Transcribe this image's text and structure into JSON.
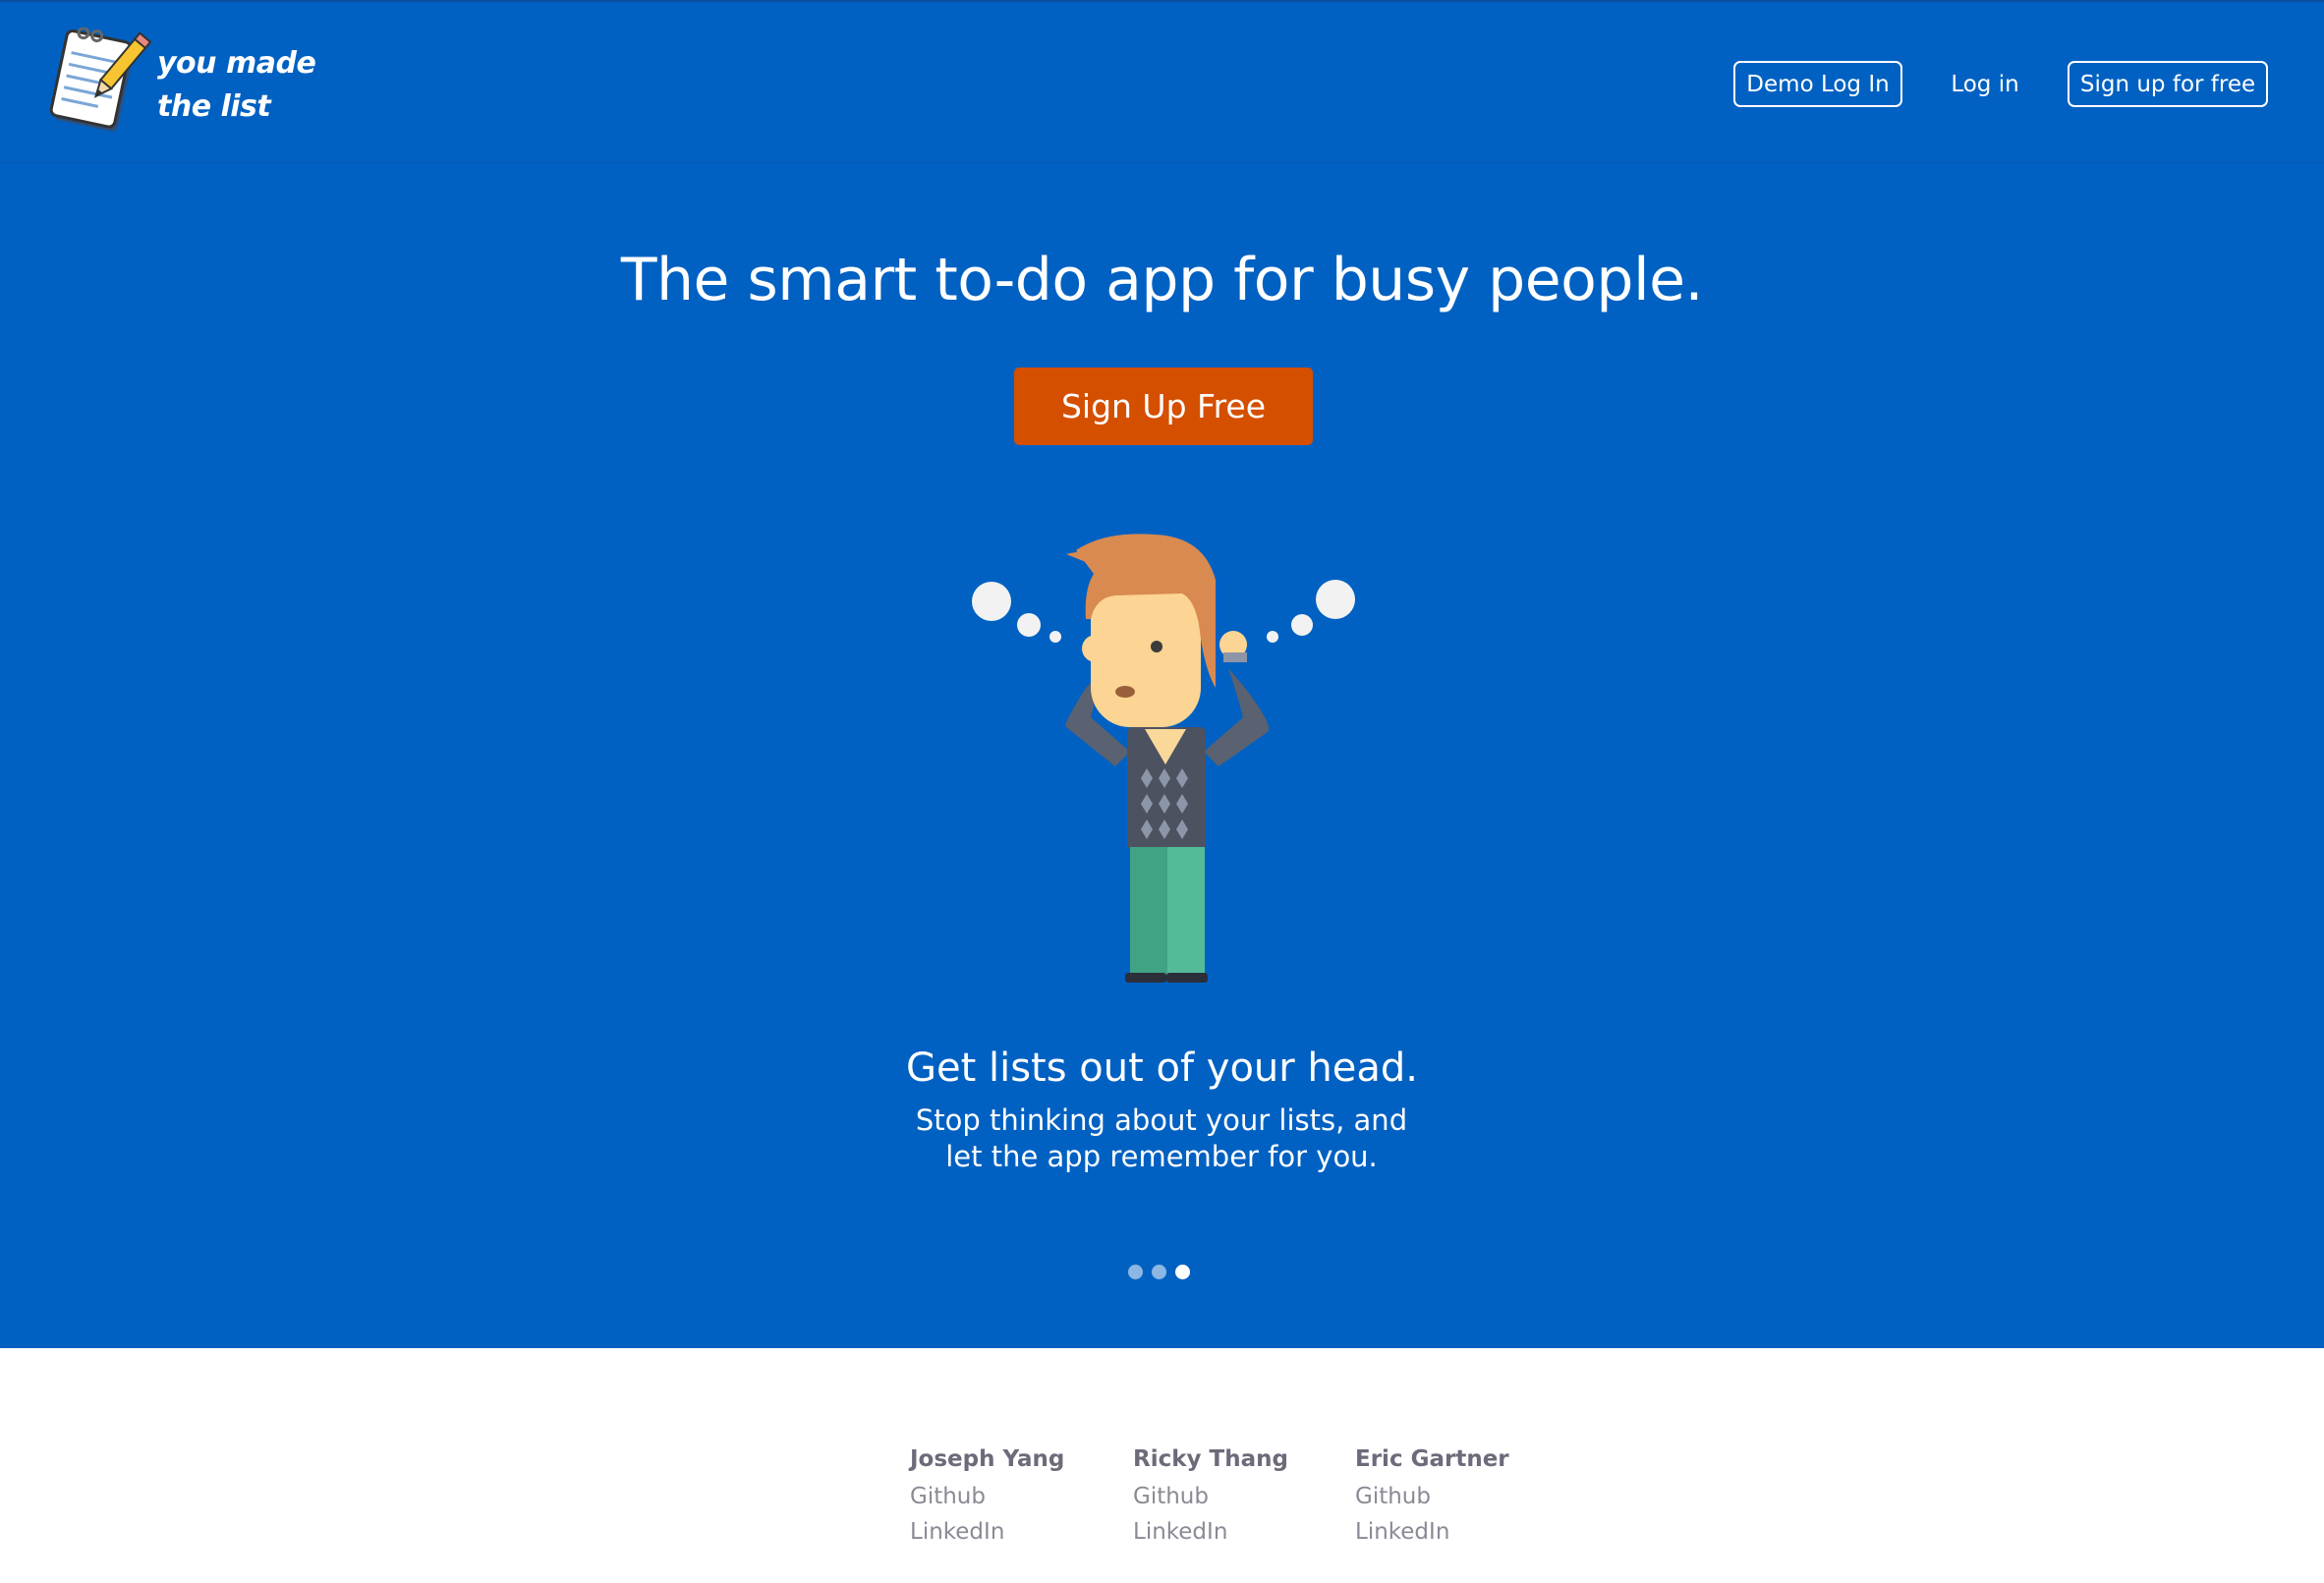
{
  "header": {
    "logo_line1": "you made",
    "logo_line2": "the list",
    "nav": {
      "demo_login": "Demo Log In",
      "login": "Log in",
      "signup": "Sign up for free"
    }
  },
  "hero": {
    "headline": "The smart to-do app for busy people.",
    "cta_label": "Sign Up Free",
    "slide_title": "Get lists out of your head.",
    "slide_body_line1": "Stop thinking about your lists, and",
    "slide_body_line2": "let the app remember for you.",
    "carousel": {
      "total_slides": 3,
      "active_index": 2
    }
  },
  "footer": {
    "authors": [
      {
        "name": "Joseph Yang",
        "links": [
          "Github",
          "LinkedIn"
        ]
      },
      {
        "name": "Ricky Thang",
        "links": [
          "Github",
          "LinkedIn"
        ]
      },
      {
        "name": "Eric Gartner",
        "links": [
          "Github",
          "LinkedIn"
        ]
      }
    ]
  },
  "colors": {
    "hero_background": "#0061c2",
    "cta_background": "#d44f00",
    "footer_name": "#6b6b7a",
    "footer_link": "#8a8a96"
  },
  "icons": {
    "logo": "notepad-pencil-icon",
    "illustration": "thinking-man-illustration"
  }
}
